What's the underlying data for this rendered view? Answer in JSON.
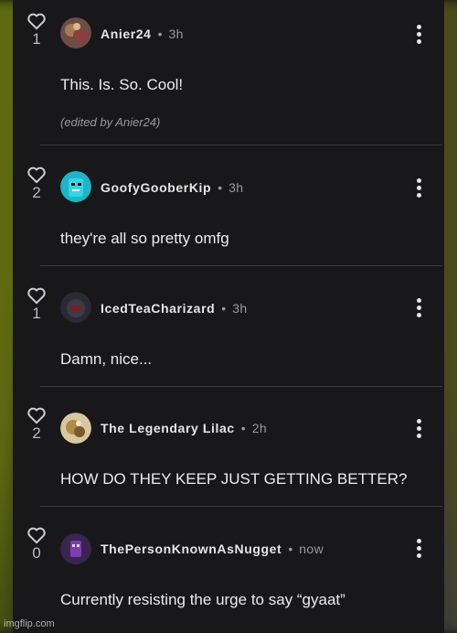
{
  "comments": [
    {
      "username": "Anier24",
      "separator": "•",
      "time": "3h",
      "votes": "1",
      "text": "This. Is. So. Cool!",
      "edited": "(edited by Anier24)"
    },
    {
      "username": "GoofyGooberKip",
      "separator": "•",
      "time": "3h",
      "votes": "2",
      "text": " they're all so pretty omfg"
    },
    {
      "username": "IcedTeaCharizard",
      "separator": "•",
      "time": "3h",
      "votes": "1",
      "text": "Damn, nice..."
    },
    {
      "username": "The Legendary Lilac",
      "separator": "•",
      "time": "2h",
      "votes": "2",
      "text": "HOW DO THEY KEEP JUST GETTING BETTER?"
    },
    {
      "username": "ThePersonKnownAsNugget",
      "separator": "•",
      "time": "now",
      "votes": "0",
      "text": "Currently resisting the urge to say “gyaat”"
    }
  ],
  "watermark": "imgflip.com",
  "icons": {
    "like": "heart-outline-icon",
    "menu": "vertical-dots-icon"
  },
  "colors": {
    "panel": "#18181a",
    "text": "#ececec",
    "muted": "#9a9a9a",
    "divider": "#3c3c40"
  }
}
